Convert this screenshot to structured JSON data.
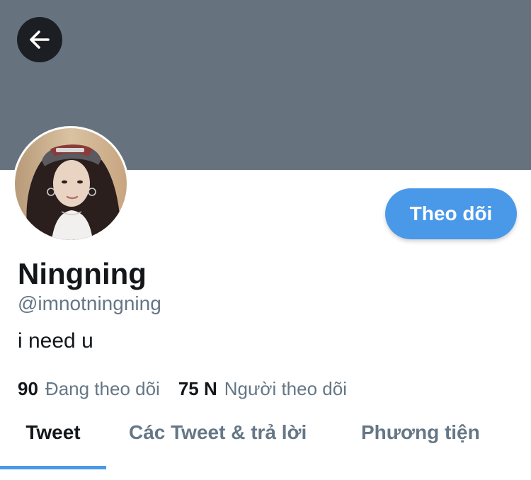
{
  "header": {
    "back_icon": "arrow-left-icon"
  },
  "profile": {
    "name": "Ningning",
    "handle": "@imnotningning",
    "bio": "i need u",
    "avatar_description": "profile photo"
  },
  "actions": {
    "follow_label": "Theo dõi"
  },
  "stats": {
    "following_count": "90",
    "following_label": "Đang theo dõi",
    "followers_count": "75 N",
    "followers_label": "Người theo dõi"
  },
  "tabs": [
    {
      "label": "Tweet",
      "active": true
    },
    {
      "label": "Các Tweet & trả lời",
      "active": false
    },
    {
      "label": "Phương tiện",
      "active": false
    }
  ],
  "colors": {
    "banner": "#66737f",
    "accent": "#4a99e9",
    "secondary_text": "#657786"
  }
}
